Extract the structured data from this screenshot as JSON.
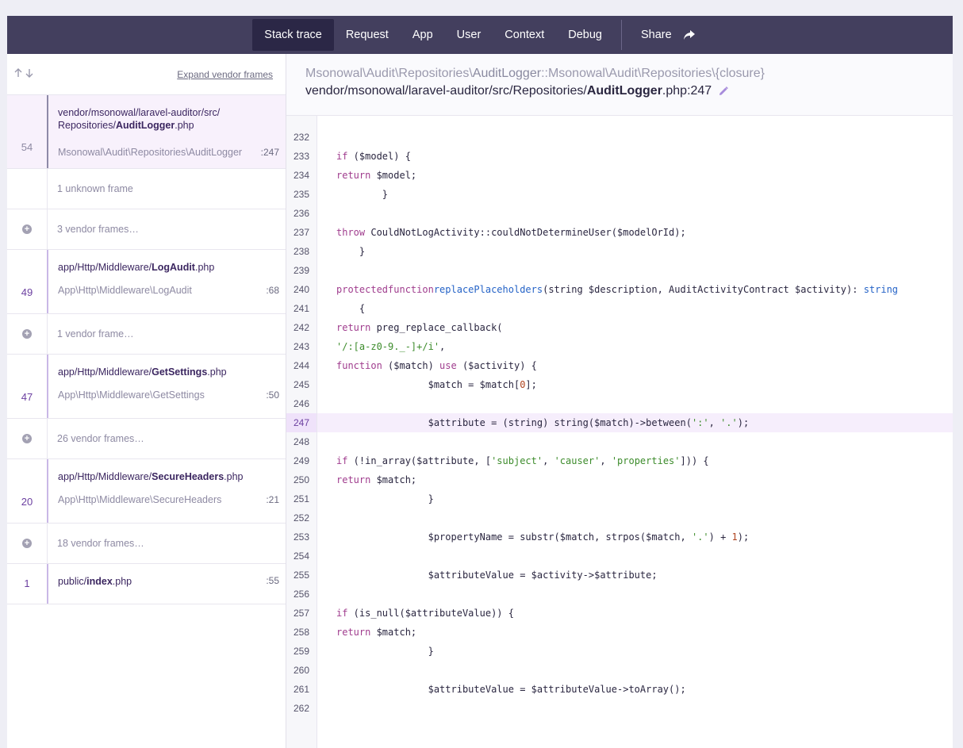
{
  "nav": {
    "tabs": [
      "Stack trace",
      "Request",
      "App",
      "User",
      "Context",
      "Debug"
    ],
    "share_label": "Share"
  },
  "sidebar": {
    "expand_label": "Expand vendor frames",
    "frames": [
      {
        "kind": "frame",
        "num": "54",
        "path_pre": "vendor/msonowal/laravel-auditor/src/",
        "path_pre2": "Repositories/",
        "path_bold": "AuditLogger",
        "path_ext": ".php",
        "cls": "Msonowal\\Audit\\Repositories\\AuditLogger",
        "line": ":247",
        "selected": true
      },
      {
        "kind": "collapsed",
        "label": "1 unknown frame",
        "icon": false
      },
      {
        "kind": "collapsed",
        "label": "3 vendor frames…",
        "icon": true
      },
      {
        "kind": "frame",
        "num": "49",
        "path_pre": "app/Http/Middleware/",
        "path_bold": "LogAudit",
        "path_ext": ".php",
        "cls": "App\\Http\\Middleware\\LogAudit",
        "line": ":68"
      },
      {
        "kind": "collapsed",
        "label": "1 vendor frame…",
        "icon": true
      },
      {
        "kind": "frame",
        "num": "47",
        "path_pre": "app/Http/Middleware/",
        "path_bold": "GetSettings",
        "path_ext": ".php",
        "cls": "App\\Http\\Middleware\\GetSettings",
        "line": ":50"
      },
      {
        "kind": "collapsed",
        "label": "26 vendor frames…",
        "icon": true
      },
      {
        "kind": "frame",
        "num": "20",
        "path_pre": "app/Http/Middleware/",
        "path_bold": "SecureHeaders",
        "path_ext": ".php",
        "cls": "App\\Http\\Middleware\\SecureHeaders",
        "line": ":21"
      },
      {
        "kind": "collapsed",
        "label": "18 vendor frames…",
        "icon": true
      },
      {
        "kind": "frame",
        "num": "1",
        "path_pre": "public/",
        "path_bold": "index",
        "path_ext": ".php",
        "cls": "",
        "line": ":55"
      }
    ]
  },
  "main": {
    "class_prefix": "Msonowal\\Audit\\Repositories\\",
    "class_name": "AuditLogger",
    "class_suffix": "::Msonowal\\Audit\\Repositories\\{closure}",
    "file_prefix": "vendor/msonowal/laravel-auditor/src/Repositories/",
    "file_name": "AuditLogger",
    "file_suffix": ".php:247",
    "highlight_line": 247,
    "code": [
      {
        "n": 232,
        "t": ""
      },
      {
        "n": 233,
        "t": "        <kw>if</kw> ($model) {"
      },
      {
        "n": 234,
        "t": "            <kw>return</kw> $model;"
      },
      {
        "n": 235,
        "t": "        }"
      },
      {
        "n": 236,
        "t": ""
      },
      {
        "n": 237,
        "t": "        <kw>throw</kw> CouldNotLogActivity::couldNotDetermineUser($modelOrId);"
      },
      {
        "n": 238,
        "t": "    }"
      },
      {
        "n": 239,
        "t": ""
      },
      {
        "n": 240,
        "t": "    <kw>protected</kw> <kw>function</kw> <fn>replacePlaceholders</fn>(string $description, AuditActivityContract $activity): <fn>string</fn>"
      },
      {
        "n": 241,
        "t": "    {"
      },
      {
        "n": 242,
        "t": "        <kw>return</kw> preg_replace_callback("
      },
      {
        "n": 243,
        "t": "            <str>'/:[a-z0-9._-]+/i'</str>,"
      },
      {
        "n": 244,
        "t": "            <kw>function</kw> ($match) <kw>use</kw> ($activity) {"
      },
      {
        "n": 245,
        "t": "                $match = $match[<num>0</num>];"
      },
      {
        "n": 246,
        "t": ""
      },
      {
        "n": 247,
        "t": "                $attribute = (string) string($match)->between(<str>':'</str>, <str>'.'</str>);"
      },
      {
        "n": 248,
        "t": ""
      },
      {
        "n": 249,
        "t": "                <kw>if</kw> (!in_array($attribute, [<str>'subject'</str>, <str>'causer'</str>, <str>'properties'</str>])) {"
      },
      {
        "n": 250,
        "t": "                    <kw>return</kw> $match;"
      },
      {
        "n": 251,
        "t": "                }"
      },
      {
        "n": 252,
        "t": ""
      },
      {
        "n": 253,
        "t": "                $propertyName = substr($match, strpos($match, <str>'.'</str>) + <num>1</num>);"
      },
      {
        "n": 254,
        "t": ""
      },
      {
        "n": 255,
        "t": "                $attributeValue = $activity->$attribute;"
      },
      {
        "n": 256,
        "t": ""
      },
      {
        "n": 257,
        "t": "                <kw>if</kw> (is_null($attributeValue)) {"
      },
      {
        "n": 258,
        "t": "                    <kw>return</kw> $match;"
      },
      {
        "n": 259,
        "t": "                }"
      },
      {
        "n": 260,
        "t": ""
      },
      {
        "n": 261,
        "t": "                $attributeValue = $attributeValue->toArray();"
      },
      {
        "n": 262,
        "t": ""
      }
    ]
  },
  "colors": {
    "nav_bg": "#433f5e",
    "nav_active": "#2b2746",
    "accent": "#7c3aed",
    "highlight": "#f6eefc"
  }
}
